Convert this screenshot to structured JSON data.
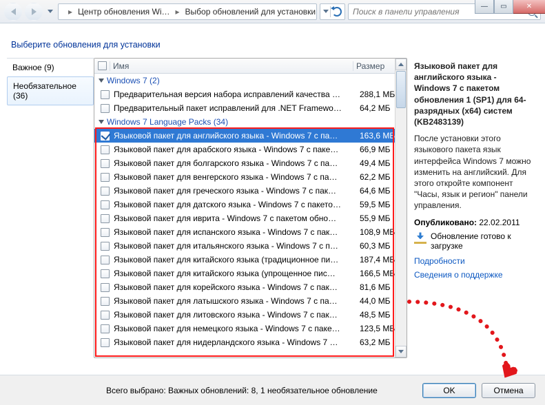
{
  "nav": {
    "bc1": "Центр обновления Wi…",
    "bc2": "Выбор обновлений для установки",
    "search_placeholder": "Поиск в панели управления"
  },
  "heading": "Выберите обновления для установки",
  "sidebar": {
    "important": "Важное (9)",
    "optional": "Необязательное (36)"
  },
  "columns": {
    "name": "Имя",
    "size": "Размер"
  },
  "groups": {
    "g1": {
      "label": "Windows 7 (2)"
    },
    "g2": {
      "label": "Windows 7 Language Packs (34)"
    }
  },
  "g1rows": [
    {
      "name": "Предварительная версия набора исправлений качества …",
      "size": "288,1 МБ"
    },
    {
      "name": "Предварительный пакет исправлений для .NET Framewo…",
      "size": "64,2 МБ"
    }
  ],
  "g2rows": [
    {
      "name": "Языковой пакет для английского языка - Windows 7 с па…",
      "size": "163,6 МБ",
      "sel": true,
      "checked": true
    },
    {
      "name": "Языковой пакет для арабского языка - Windows 7 с паке…",
      "size": "66,9 МБ"
    },
    {
      "name": "Языковой пакет для болгарского языка - Windows 7 с па…",
      "size": "49,4 МБ"
    },
    {
      "name": "Языковой пакет для венгерского языка - Windows 7 с па…",
      "size": "62,2 МБ"
    },
    {
      "name": "Языковой пакет для греческого языка - Windows 7 с пак…",
      "size": "64,6 МБ"
    },
    {
      "name": "Языковой пакет для датского языка - Windows 7 с пакето…",
      "size": "59,5 МБ"
    },
    {
      "name": "Языковой пакет для иврита - Windows 7 с пакетом обно…",
      "size": "55,9 МБ"
    },
    {
      "name": "Языковой пакет для испанского языка - Windows 7 с пак…",
      "size": "108,9 МБ"
    },
    {
      "name": "Языковой пакет для итальянского языка - Windows 7 с п…",
      "size": "60,3 МБ"
    },
    {
      "name": "Языковой пакет для китайского языка (традиционное пи…",
      "size": "187,4 МБ"
    },
    {
      "name": "Языковой пакет для китайского языка (упрощенное пис…",
      "size": "166,5 МБ"
    },
    {
      "name": "Языковой пакет для корейского языка - Windows 7 с пак…",
      "size": "81,6 МБ"
    },
    {
      "name": "Языковой пакет для латышского языка - Windows 7 с па…",
      "size": "44,0 МБ"
    },
    {
      "name": "Языковой пакет для литовского языка - Windows 7 с пак…",
      "size": "48,5 МБ"
    },
    {
      "name": "Языковой пакет для немецкого языка - Windows 7 с паке…",
      "size": "123,5 МБ"
    },
    {
      "name": "Языковой пакет для нидерландского языка - Windows 7 …",
      "size": "63,2 МБ"
    }
  ],
  "details": {
    "title": "Языковой пакет для английского языка - Windows 7 с пакетом обновления 1 (SP1) для 64-разрядных (x64) систем (KB2483139)",
    "desc": "После установки этого языкового пакета язык интерфейса Windows 7 можно изменить на английский. Для этого откройте компонент \"Часы, язык и регион\" панели управления.",
    "pub_label": "Опубликовано:",
    "pub_value": "22.02.2011",
    "ready": "Обновление готово к загрузке",
    "link1": "Подробности",
    "link2": "Сведения о поддержке"
  },
  "footer": {
    "summary": "Всего выбрано: Важных обновлений: 8, 1 необязательное обновление",
    "ok": "OK",
    "cancel": "Отмена"
  }
}
